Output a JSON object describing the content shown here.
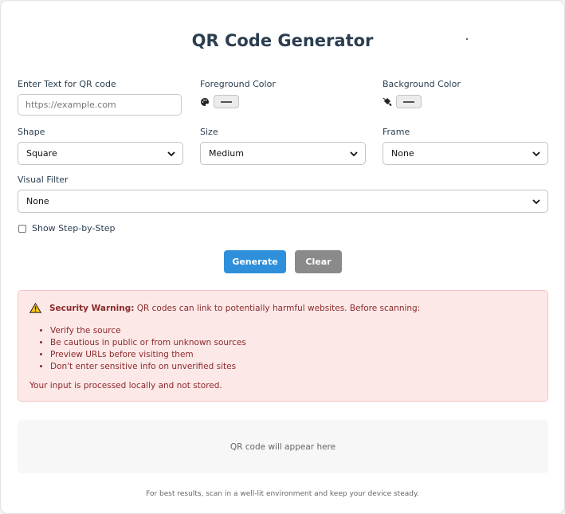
{
  "title": "QR Code Generator",
  "text_input": {
    "label": "Enter Text for QR code",
    "placeholder": "https://example.com",
    "value": ""
  },
  "foreground": {
    "label": "Foreground Color",
    "icon": "palette-icon"
  },
  "background": {
    "label": "Background Color",
    "icon": "paint-bucket-icon"
  },
  "shape": {
    "label": "Shape",
    "selected": "Square"
  },
  "size": {
    "label": "Size",
    "selected": "Medium"
  },
  "frame": {
    "label": "Frame",
    "selected": "None"
  },
  "visual_filter": {
    "label": "Visual Filter",
    "selected": "None"
  },
  "step_by_step": {
    "label": "Show Step-by-Step",
    "checked": false
  },
  "buttons": {
    "generate": "Generate",
    "clear": "Clear"
  },
  "warning": {
    "heading": "Security Warning:",
    "text": "QR codes can link to potentially harmful websites. Before scanning:",
    "items": [
      "Verify the source",
      "Be cautious in public or from unknown sources",
      "Preview URLs before visiting them",
      "Don't enter sensitive info on unverified sites"
    ],
    "footer": "Your input is processed locally and not stored."
  },
  "qr_placeholder": "QR code will appear here",
  "tip": "For best results, scan in a well-lit environment and keep your device steady.",
  "colors": {
    "primary": "#2e8fdb",
    "secondary": "#8a8a8a",
    "warning_bg": "#fde8e8",
    "warning_text": "#8b2a2a",
    "title": "#2c3e50"
  }
}
